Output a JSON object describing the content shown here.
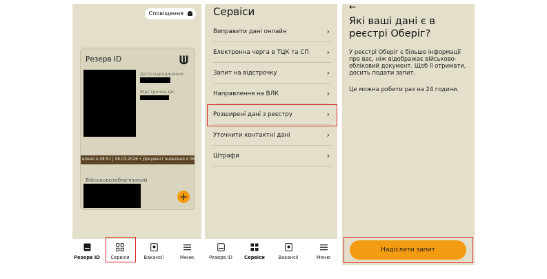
{
  "panel1": {
    "notification_button": "Сповіщення",
    "card": {
      "title": "Резерв ID",
      "birth_date_label": "Дата народження:",
      "deferral_label": "Відстрочка до:",
      "ticker_text": "влено о 08:51 | 08.03.2026 • Документ оновлено о 08:51",
      "status_label": "Військовозобов'язаний",
      "add_button": "+"
    },
    "tabbar": [
      {
        "label": "Резерв ID",
        "icon": "id-card-icon"
      },
      {
        "label": "Сервіси",
        "icon": "grid-icon"
      },
      {
        "label": "Вакансії",
        "icon": "vacancy-icon"
      },
      {
        "label": "Меню",
        "icon": "menu-icon"
      }
    ]
  },
  "panel2": {
    "title": "Сервіси",
    "items": [
      "Виправити дані онлайн",
      "Електронна черга в ТЦК та СП",
      "Запит на відстрочку",
      "Направлення на ВЛК",
      "Розширені дані з реєстру",
      "Уточнити контактні дані",
      "Штрафи"
    ],
    "chevron": "›",
    "tabbar": [
      {
        "label": "Резерв ID",
        "icon": "id-card-icon"
      },
      {
        "label": "Сервіси",
        "icon": "grid-icon"
      },
      {
        "label": "Вакансії",
        "icon": "vacancy-icon"
      },
      {
        "label": "Меню",
        "icon": "menu-icon"
      }
    ]
  },
  "panel3": {
    "back_arrow": "←",
    "title": "Які ваші дані є в реєстрі Оберіг?",
    "body": "У реєстрі Оберіг є більше інформації про вас, ніж відображає військово-обліковий документ. Щоб її отримати, досить подати запит.",
    "note": "Це можна робити раз на 24 години.",
    "send_button": "Надіслати запит"
  },
  "colors": {
    "panel_bg": "#e3dfcb",
    "accent": "#f39c12",
    "highlight": "#d92a2a",
    "ticker_bg": "#5c4627"
  }
}
